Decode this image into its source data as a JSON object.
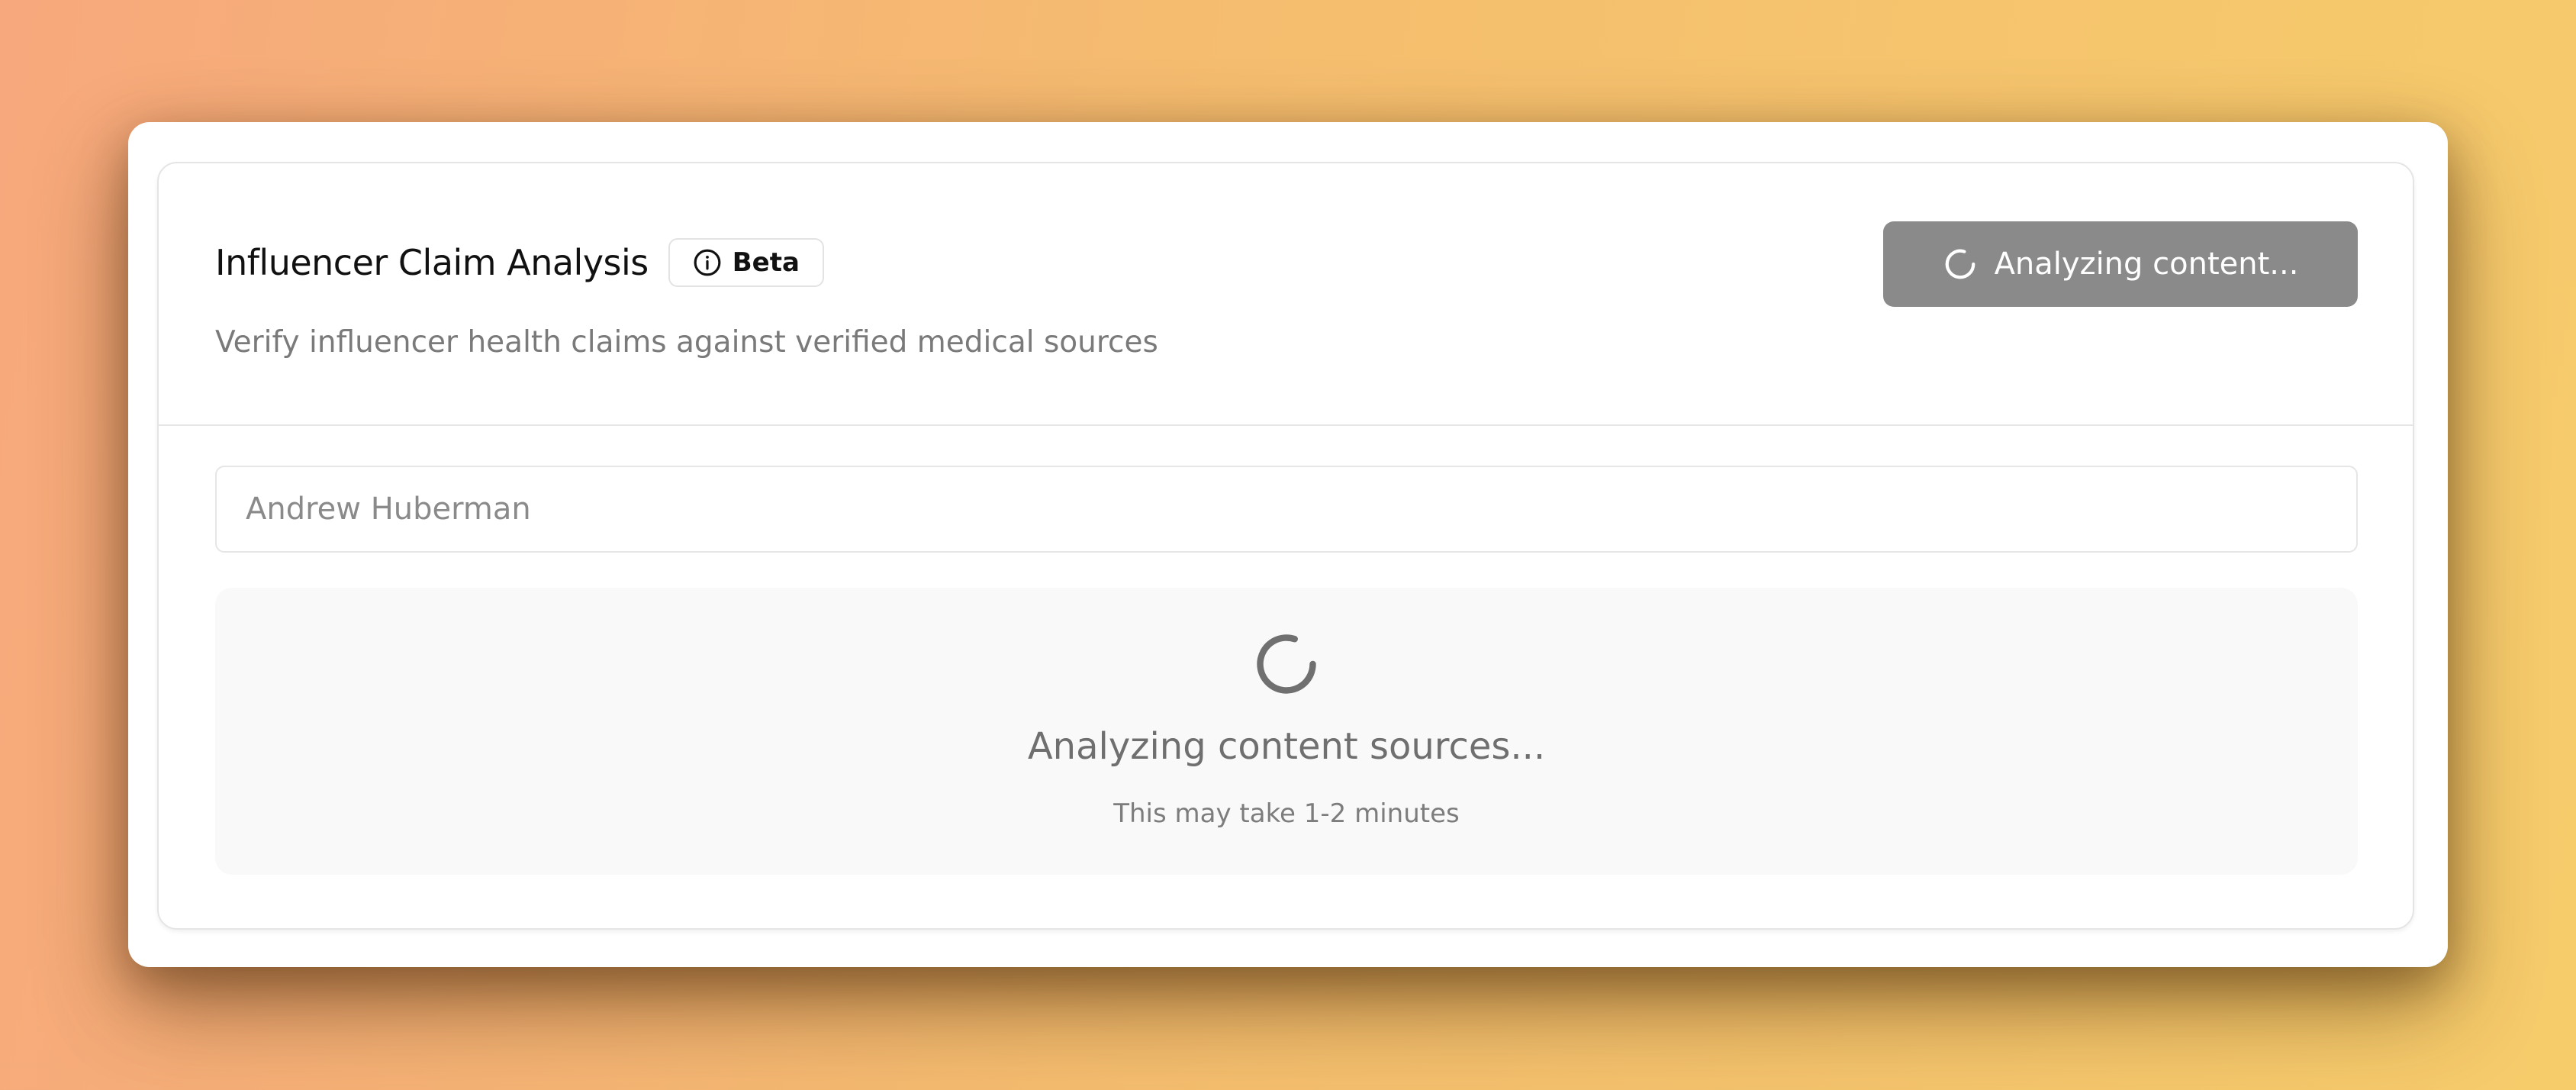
{
  "header": {
    "title": "Influencer Claim Analysis",
    "badge_label": "Beta",
    "badge_icon": "info-circle-icon",
    "subtitle": "Verify influencer health claims against verified medical sources",
    "analyze_button_label": "Analyzing content...",
    "analyze_button_icon": "loader-icon"
  },
  "search": {
    "value": "Andrew Huberman",
    "placeholder": ""
  },
  "loading": {
    "icon": "loader-icon",
    "title": "Analyzing content sources...",
    "subtitle": "This may take 1-2 minutes"
  },
  "colors": {
    "button_disabled": "#8a8a8a",
    "panel_background": "#f9f9f9",
    "muted_text": "#7a7a7a"
  }
}
